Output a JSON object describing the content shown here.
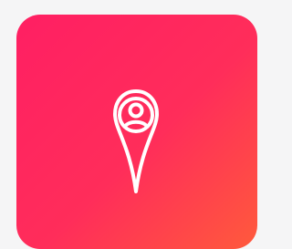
{
  "app_tile": {
    "icon": "location-person-pin-icon",
    "gradient": {
      "start": "#ff1f63",
      "mid": "#ff2d5a",
      "end": "#ff5a3c"
    },
    "icon_color": "#ffffff",
    "background": "#f5f5f6"
  }
}
